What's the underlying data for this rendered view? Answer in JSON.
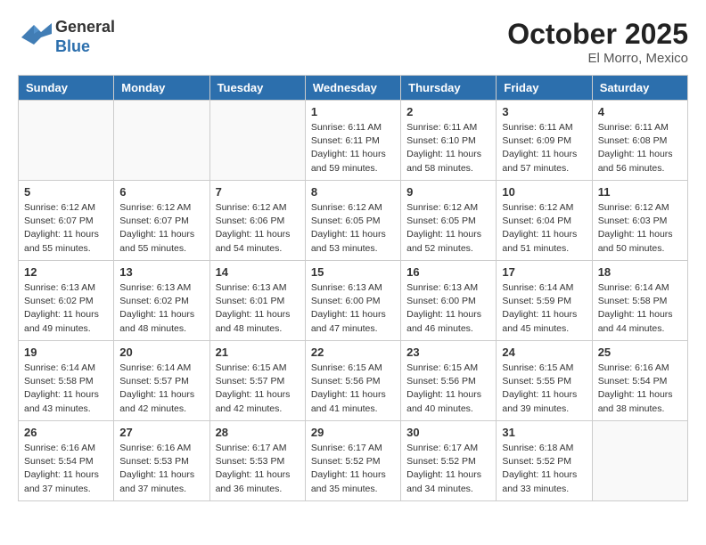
{
  "header": {
    "logo_line1": "General",
    "logo_line2": "Blue",
    "month": "October 2025",
    "location": "El Morro, Mexico"
  },
  "weekdays": [
    "Sunday",
    "Monday",
    "Tuesday",
    "Wednesday",
    "Thursday",
    "Friday",
    "Saturday"
  ],
  "weeks": [
    [
      {
        "day": "",
        "info": ""
      },
      {
        "day": "",
        "info": ""
      },
      {
        "day": "",
        "info": ""
      },
      {
        "day": "1",
        "info": "Sunrise: 6:11 AM\nSunset: 6:11 PM\nDaylight: 11 hours\nand 59 minutes."
      },
      {
        "day": "2",
        "info": "Sunrise: 6:11 AM\nSunset: 6:10 PM\nDaylight: 11 hours\nand 58 minutes."
      },
      {
        "day": "3",
        "info": "Sunrise: 6:11 AM\nSunset: 6:09 PM\nDaylight: 11 hours\nand 57 minutes."
      },
      {
        "day": "4",
        "info": "Sunrise: 6:11 AM\nSunset: 6:08 PM\nDaylight: 11 hours\nand 56 minutes."
      }
    ],
    [
      {
        "day": "5",
        "info": "Sunrise: 6:12 AM\nSunset: 6:07 PM\nDaylight: 11 hours\nand 55 minutes."
      },
      {
        "day": "6",
        "info": "Sunrise: 6:12 AM\nSunset: 6:07 PM\nDaylight: 11 hours\nand 55 minutes."
      },
      {
        "day": "7",
        "info": "Sunrise: 6:12 AM\nSunset: 6:06 PM\nDaylight: 11 hours\nand 54 minutes."
      },
      {
        "day": "8",
        "info": "Sunrise: 6:12 AM\nSunset: 6:05 PM\nDaylight: 11 hours\nand 53 minutes."
      },
      {
        "day": "9",
        "info": "Sunrise: 6:12 AM\nSunset: 6:05 PM\nDaylight: 11 hours\nand 52 minutes."
      },
      {
        "day": "10",
        "info": "Sunrise: 6:12 AM\nSunset: 6:04 PM\nDaylight: 11 hours\nand 51 minutes."
      },
      {
        "day": "11",
        "info": "Sunrise: 6:12 AM\nSunset: 6:03 PM\nDaylight: 11 hours\nand 50 minutes."
      }
    ],
    [
      {
        "day": "12",
        "info": "Sunrise: 6:13 AM\nSunset: 6:02 PM\nDaylight: 11 hours\nand 49 minutes."
      },
      {
        "day": "13",
        "info": "Sunrise: 6:13 AM\nSunset: 6:02 PM\nDaylight: 11 hours\nand 48 minutes."
      },
      {
        "day": "14",
        "info": "Sunrise: 6:13 AM\nSunset: 6:01 PM\nDaylight: 11 hours\nand 48 minutes."
      },
      {
        "day": "15",
        "info": "Sunrise: 6:13 AM\nSunset: 6:00 PM\nDaylight: 11 hours\nand 47 minutes."
      },
      {
        "day": "16",
        "info": "Sunrise: 6:13 AM\nSunset: 6:00 PM\nDaylight: 11 hours\nand 46 minutes."
      },
      {
        "day": "17",
        "info": "Sunrise: 6:14 AM\nSunset: 5:59 PM\nDaylight: 11 hours\nand 45 minutes."
      },
      {
        "day": "18",
        "info": "Sunrise: 6:14 AM\nSunset: 5:58 PM\nDaylight: 11 hours\nand 44 minutes."
      }
    ],
    [
      {
        "day": "19",
        "info": "Sunrise: 6:14 AM\nSunset: 5:58 PM\nDaylight: 11 hours\nand 43 minutes."
      },
      {
        "day": "20",
        "info": "Sunrise: 6:14 AM\nSunset: 5:57 PM\nDaylight: 11 hours\nand 42 minutes."
      },
      {
        "day": "21",
        "info": "Sunrise: 6:15 AM\nSunset: 5:57 PM\nDaylight: 11 hours\nand 42 minutes."
      },
      {
        "day": "22",
        "info": "Sunrise: 6:15 AM\nSunset: 5:56 PM\nDaylight: 11 hours\nand 41 minutes."
      },
      {
        "day": "23",
        "info": "Sunrise: 6:15 AM\nSunset: 5:56 PM\nDaylight: 11 hours\nand 40 minutes."
      },
      {
        "day": "24",
        "info": "Sunrise: 6:15 AM\nSunset: 5:55 PM\nDaylight: 11 hours\nand 39 minutes."
      },
      {
        "day": "25",
        "info": "Sunrise: 6:16 AM\nSunset: 5:54 PM\nDaylight: 11 hours\nand 38 minutes."
      }
    ],
    [
      {
        "day": "26",
        "info": "Sunrise: 6:16 AM\nSunset: 5:54 PM\nDaylight: 11 hours\nand 37 minutes."
      },
      {
        "day": "27",
        "info": "Sunrise: 6:16 AM\nSunset: 5:53 PM\nDaylight: 11 hours\nand 37 minutes."
      },
      {
        "day": "28",
        "info": "Sunrise: 6:17 AM\nSunset: 5:53 PM\nDaylight: 11 hours\nand 36 minutes."
      },
      {
        "day": "29",
        "info": "Sunrise: 6:17 AM\nSunset: 5:52 PM\nDaylight: 11 hours\nand 35 minutes."
      },
      {
        "day": "30",
        "info": "Sunrise: 6:17 AM\nSunset: 5:52 PM\nDaylight: 11 hours\nand 34 minutes."
      },
      {
        "day": "31",
        "info": "Sunrise: 6:18 AM\nSunset: 5:52 PM\nDaylight: 11 hours\nand 33 minutes."
      },
      {
        "day": "",
        "info": ""
      }
    ]
  ]
}
